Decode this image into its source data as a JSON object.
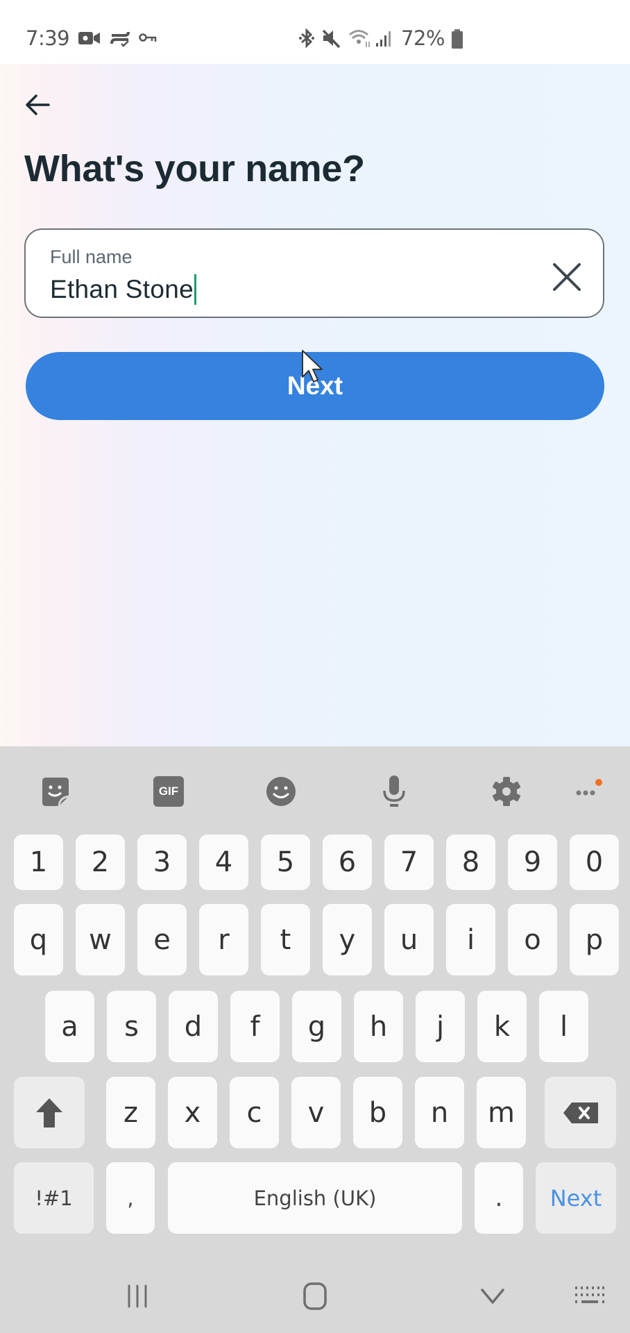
{
  "status_bar": {
    "time": "7:39",
    "left_icons": [
      "video-camera-icon",
      "sync-check-icon",
      "vpn-key-icon"
    ],
    "right_icons": [
      "bluetooth-icon",
      "mute-icon",
      "wifi-icon",
      "signal-icon",
      "battery-icon"
    ],
    "battery_percent": "72%"
  },
  "screen": {
    "back_icon": "arrow-left-icon",
    "title": "What's your name?",
    "name_field": {
      "label": "Full name",
      "value": "Ethan Stone",
      "clear_icon": "close-icon"
    },
    "next_button": {
      "label": "Next",
      "color": "#3582df"
    }
  },
  "keyboard": {
    "toolbar": [
      "sticker-icon",
      "gif-icon",
      "emoji-icon",
      "microphone-icon",
      "settings-icon",
      "more-icon"
    ],
    "gif_label": "GIF",
    "rows": [
      [
        "1",
        "2",
        "3",
        "4",
        "5",
        "6",
        "7",
        "8",
        "9",
        "0"
      ],
      [
        "q",
        "w",
        "e",
        "r",
        "t",
        "y",
        "u",
        "i",
        "o",
        "p"
      ],
      [
        "a",
        "s",
        "d",
        "f",
        "g",
        "h",
        "j",
        "k",
        "l"
      ],
      [
        "z",
        "x",
        "c",
        "v",
        "b",
        "n",
        "m"
      ]
    ],
    "symbols_key": "!#1",
    "comma_key": ",",
    "space_key": "English (UK)",
    "period_key": ".",
    "action_key": "Next",
    "action_color": "#4a92e3",
    "notification_dot_color": "#f07020"
  },
  "nav_bar": [
    "recent-apps-icon",
    "home-icon",
    "hide-keyboard-icon",
    "keyboard-switch-icon"
  ]
}
